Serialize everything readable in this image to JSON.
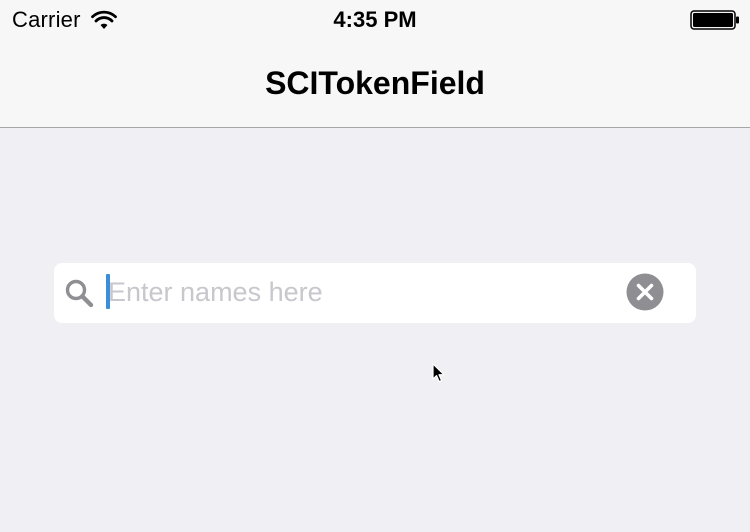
{
  "status_bar": {
    "carrier": "Carrier",
    "time": "4:35 PM",
    "wifi_icon": "wifi-icon",
    "battery_icon": "battery-icon"
  },
  "nav_bar": {
    "title": "SCITokenField"
  },
  "token_field": {
    "value": "",
    "placeholder": "Enter names here",
    "search_icon": "search-icon",
    "clear_icon": "clear-circle-icon",
    "caret_color": "#3a8fd8"
  },
  "colors": {
    "background": "#efeff4",
    "bar_background": "#f7f7f8",
    "placeholder": "#c7c7cd",
    "icon_gray": "#8e8e93"
  }
}
